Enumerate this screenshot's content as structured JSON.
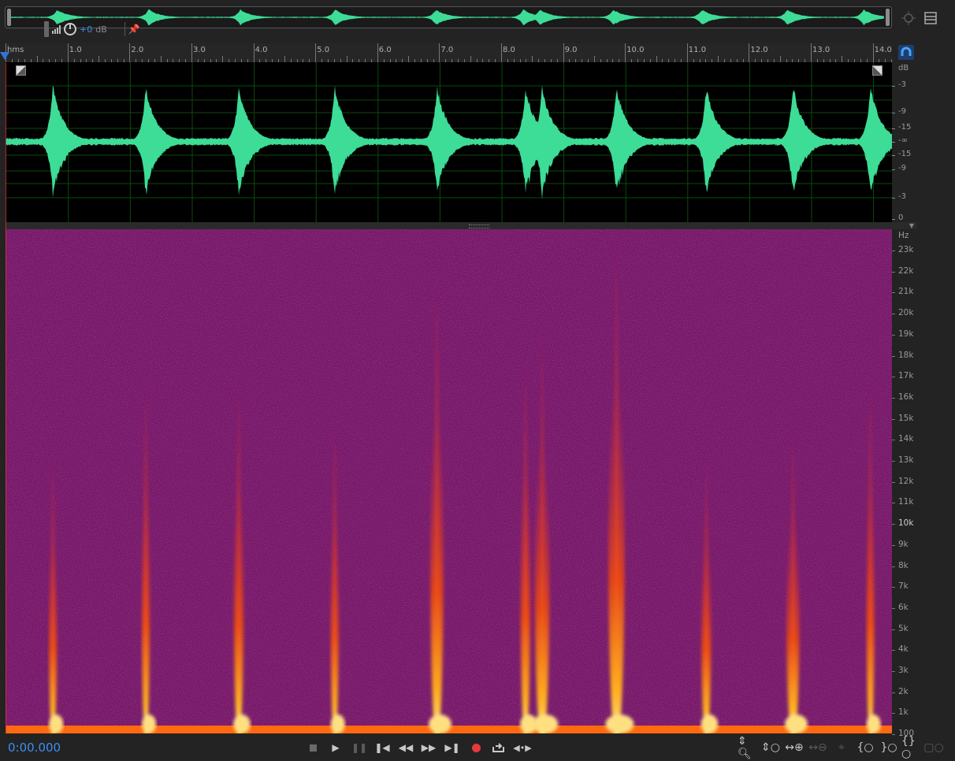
{
  "overview": {
    "gain_value": "+0",
    "gain_unit": "dB"
  },
  "ruler": {
    "unit_label": "hms",
    "labels": [
      "1.0",
      "2.0",
      "3.0",
      "4.0",
      "5.0",
      "6.0",
      "7.0",
      "8.0",
      "9.0",
      "10.0",
      "11.0",
      "12.0",
      "13.0",
      "14.0"
    ]
  },
  "waveform": {
    "clip_times_s": [
      0.75,
      2.25,
      3.75,
      5.3,
      6.95,
      8.38,
      8.65,
      9.85,
      11.3,
      12.7,
      13.95
    ],
    "db_unit": "dB",
    "db_labels": [
      "-3",
      "-9",
      "-15",
      "-∞",
      "-15",
      "-9",
      "-3",
      "0"
    ]
  },
  "spectrogram": {
    "hz_unit": "Hz",
    "hz_labels": [
      "23k",
      "22k",
      "21k",
      "20k",
      "19k",
      "18k",
      "17k",
      "16k",
      "15k",
      "14k",
      "13k",
      "12k",
      "11k",
      "10k",
      "9k",
      "8k",
      "7k",
      "6k",
      "5k",
      "4k",
      "3k",
      "2k",
      "1k",
      "100"
    ]
  },
  "transport": {
    "timecode": "0:00.000",
    "buttons": [
      "stop",
      "play",
      "pause",
      "go-to-start",
      "rewind",
      "fast-forward",
      "go-to-end",
      "record",
      "loop",
      "skip-selection"
    ]
  },
  "zoom": {
    "buttons": [
      "zoom-in-amplitude",
      "zoom-out-amplitude",
      "zoom-in-time",
      "zoom-out-time",
      "zoom-reset",
      "zoom-in-left",
      "zoom-in-right",
      "zoom-out-full",
      "zoom-selection"
    ]
  },
  "colors": {
    "accent": "#3b8ff0",
    "waveform": "#3ddc97",
    "spectro_bg": "#7a1356",
    "playhead": "#2b74d8",
    "record": "#e8393a"
  }
}
